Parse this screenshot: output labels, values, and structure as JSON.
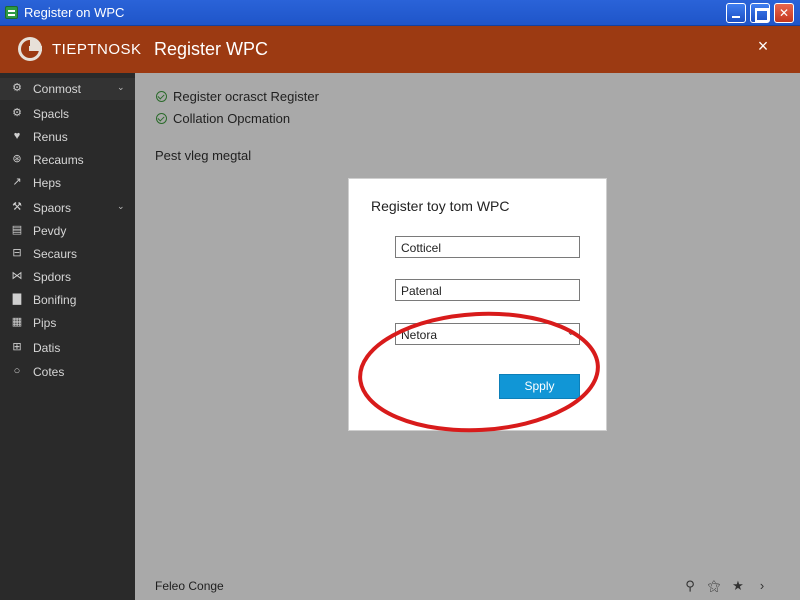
{
  "window": {
    "title": "Register on WPC",
    "app_icon": "app-window-icon",
    "buttons": [
      "minimize",
      "maximize",
      "close"
    ]
  },
  "header": {
    "brand": "TIEPTNOSK",
    "title": "Register WPC",
    "close_glyph": "×"
  },
  "sidebar": {
    "items": [
      {
        "label": "Conmost",
        "icon": "gear-icon",
        "glyph": "⚙",
        "chevron": true
      },
      {
        "label": "Spacls",
        "icon": "settings-icon",
        "glyph": "⚙",
        "chevron": false
      },
      {
        "label": "Renus",
        "icon": "heart-icon",
        "glyph": "♥",
        "chevron": false
      },
      {
        "label": "Recaums",
        "icon": "globe-icon",
        "glyph": "⊛",
        "chevron": false
      },
      {
        "label": "Heps",
        "icon": "chart-icon",
        "glyph": "↗",
        "chevron": false
      },
      {
        "label": "Spaors",
        "icon": "tools-icon",
        "glyph": "⚒",
        "chevron": true
      },
      {
        "label": "Pevdy",
        "icon": "card-icon",
        "glyph": "▤",
        "chevron": false
      },
      {
        "label": "Secaurs",
        "icon": "lock-icon",
        "glyph": "⊟",
        "chevron": false
      },
      {
        "label": "Spdors",
        "icon": "share-icon",
        "glyph": "⋈",
        "chevron": false
      },
      {
        "label": "Bonifing",
        "icon": "document-icon",
        "glyph": "▇",
        "chevron": false
      },
      {
        "label": "Pips",
        "icon": "list-icon",
        "glyph": "▦",
        "chevron": false
      },
      {
        "label": "Datis",
        "icon": "database-icon",
        "glyph": "⊞",
        "chevron": false
      },
      {
        "label": "Cotes",
        "icon": "circle-icon",
        "glyph": "○",
        "chevron": false
      }
    ]
  },
  "main": {
    "checks": [
      "Register ocrasct Register",
      "Collation Opcmation"
    ],
    "subtitle": "Pest vleg megtal",
    "footer_text": "Feleo Conge",
    "footer_icons": [
      {
        "name": "search-icon",
        "glyph": "⚲"
      },
      {
        "name": "person-icon",
        "glyph": "⚝"
      },
      {
        "name": "star-icon",
        "glyph": "★"
      },
      {
        "name": "chevron-right-icon",
        "glyph": "›"
      }
    ]
  },
  "dialog": {
    "title": "Register toy tom WPC",
    "fields": [
      {
        "value": "Cotticel"
      },
      {
        "value": "Patenal"
      },
      {
        "value": "Netora",
        "dropdown": true
      }
    ],
    "apply_label": "Spply"
  },
  "annotation": {
    "color": "#d81b1b",
    "shape": "ellipse"
  }
}
